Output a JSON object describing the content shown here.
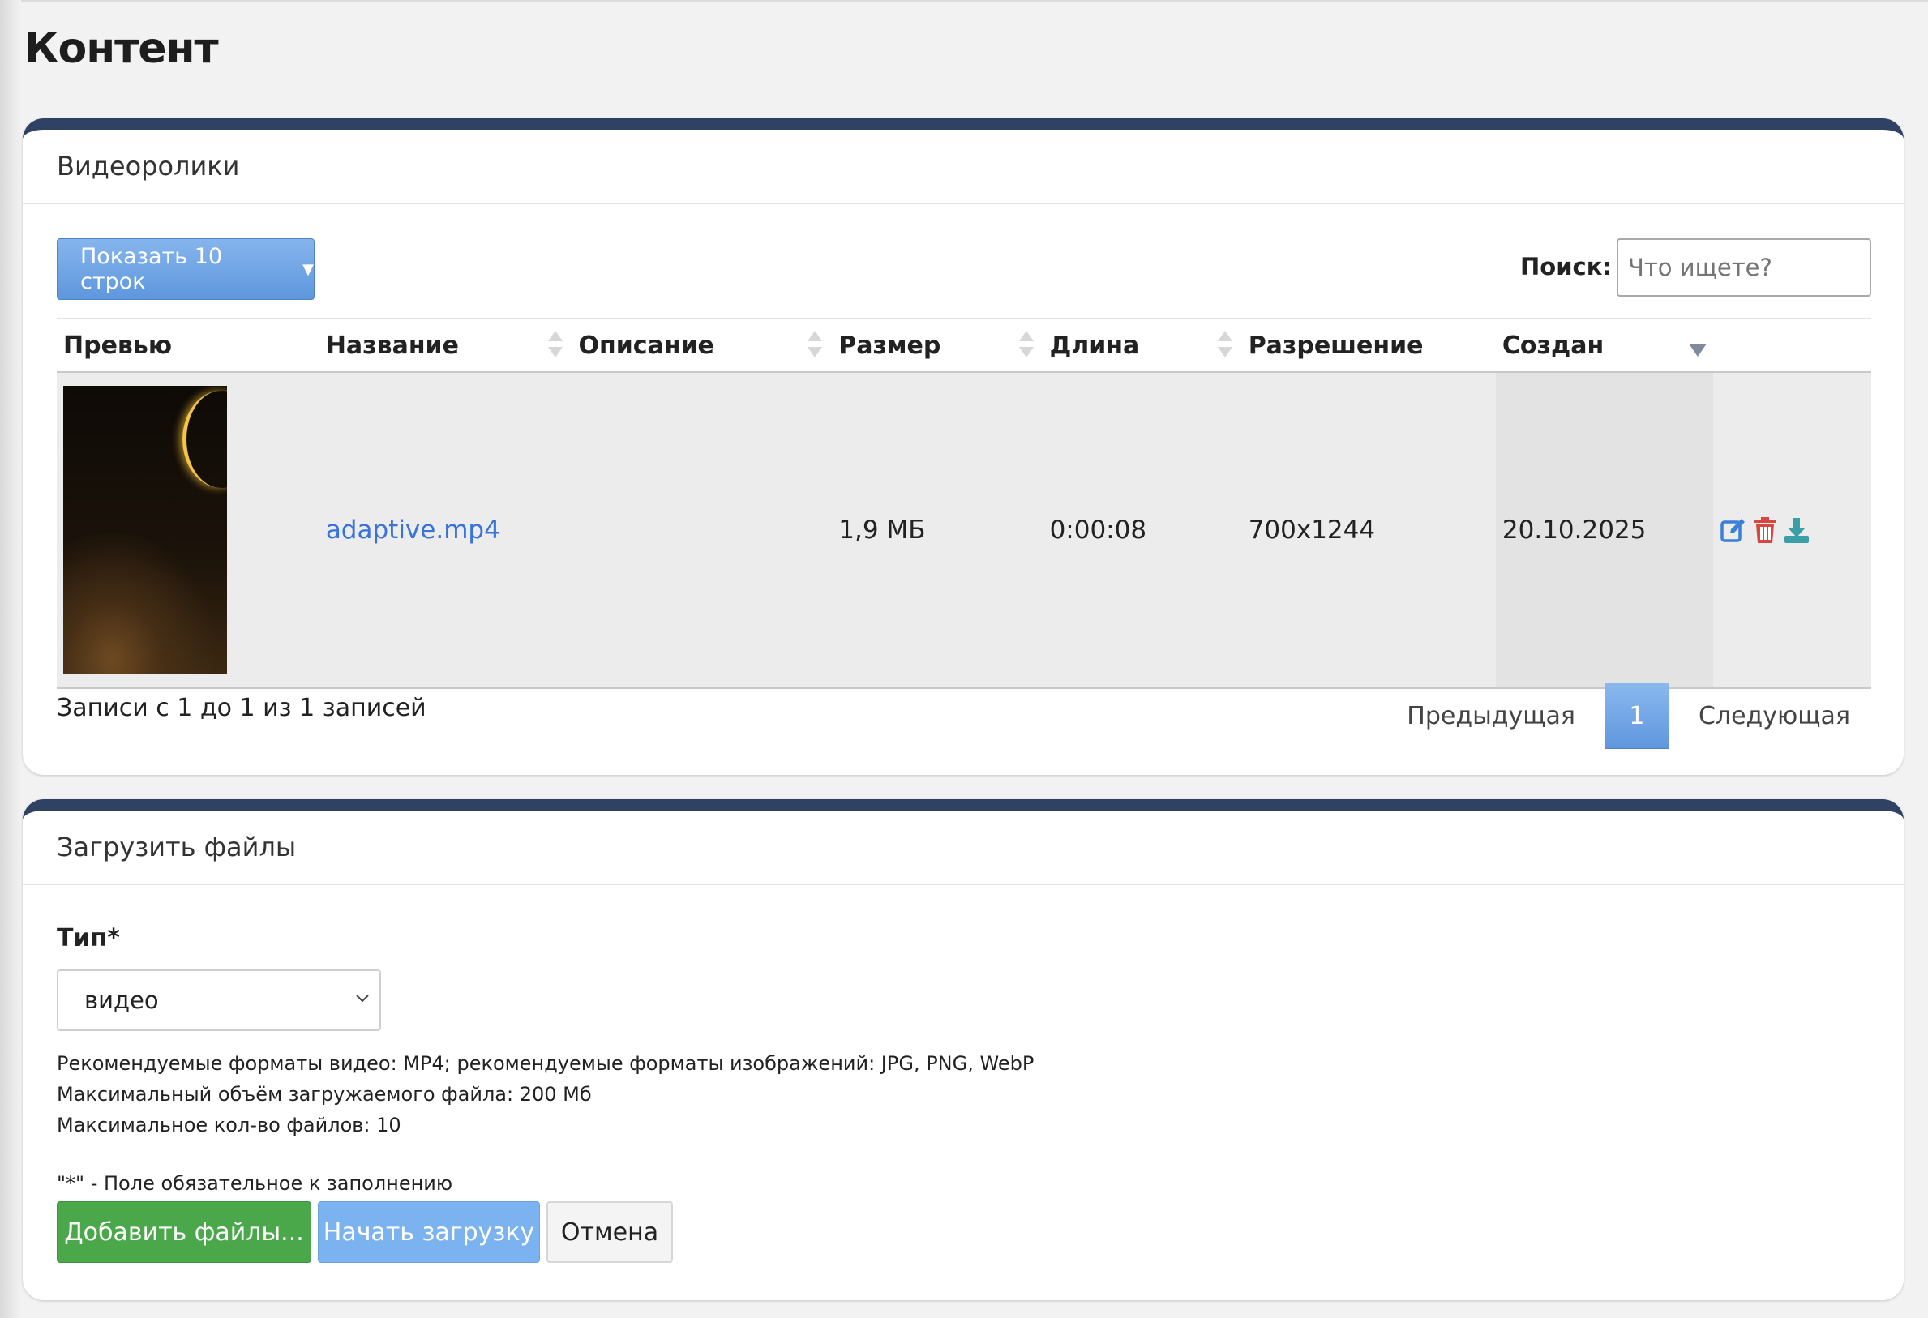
{
  "page": {
    "title": "Контент"
  },
  "videos": {
    "header": "Видеоролики",
    "length_button": "Показать 10 строк",
    "search": {
      "label": "Поиск:",
      "placeholder": "Что ищете?"
    },
    "columns": [
      "Превью",
      "Название",
      "Описание",
      "Размер",
      "Длина",
      "Разрешение",
      "Создан"
    ],
    "rows": [
      {
        "name": "adaptive.mp4",
        "description": "",
        "size": "1,9 МБ",
        "length": "0:00:08",
        "resolution": "700x1244",
        "created": "20.10.2025",
        "actions": [
          "edit-icon",
          "trash-icon",
          "download-icon"
        ]
      }
    ],
    "info": "Записи с 1 до 1 из 1 записей",
    "pagination": {
      "previous": "Предыдущая",
      "current": "1",
      "next": "Следующая"
    }
  },
  "upload": {
    "header": "Загрузить файлы",
    "type_label": "Тип*",
    "type_value": "видео",
    "hints": [
      "Рекомендуемые форматы видео: MP4; рекомендуемые форматы изображений: JPG, PNG, WebP",
      "Максимальный объём загружаемого файла: 200 Мб",
      "Максимальное кол-во файлов: 10"
    ],
    "required_note": "\"*\" - Поле обязательное к заполнению",
    "buttons": {
      "add": "Добавить файлы...",
      "start": "Начать загрузку",
      "cancel": "Отмена"
    }
  },
  "colors": {
    "accent": "#2f4264",
    "primary": "#5e97de",
    "success": "#4aa84a",
    "danger": "#d9453f",
    "link": "#3a73d8"
  }
}
